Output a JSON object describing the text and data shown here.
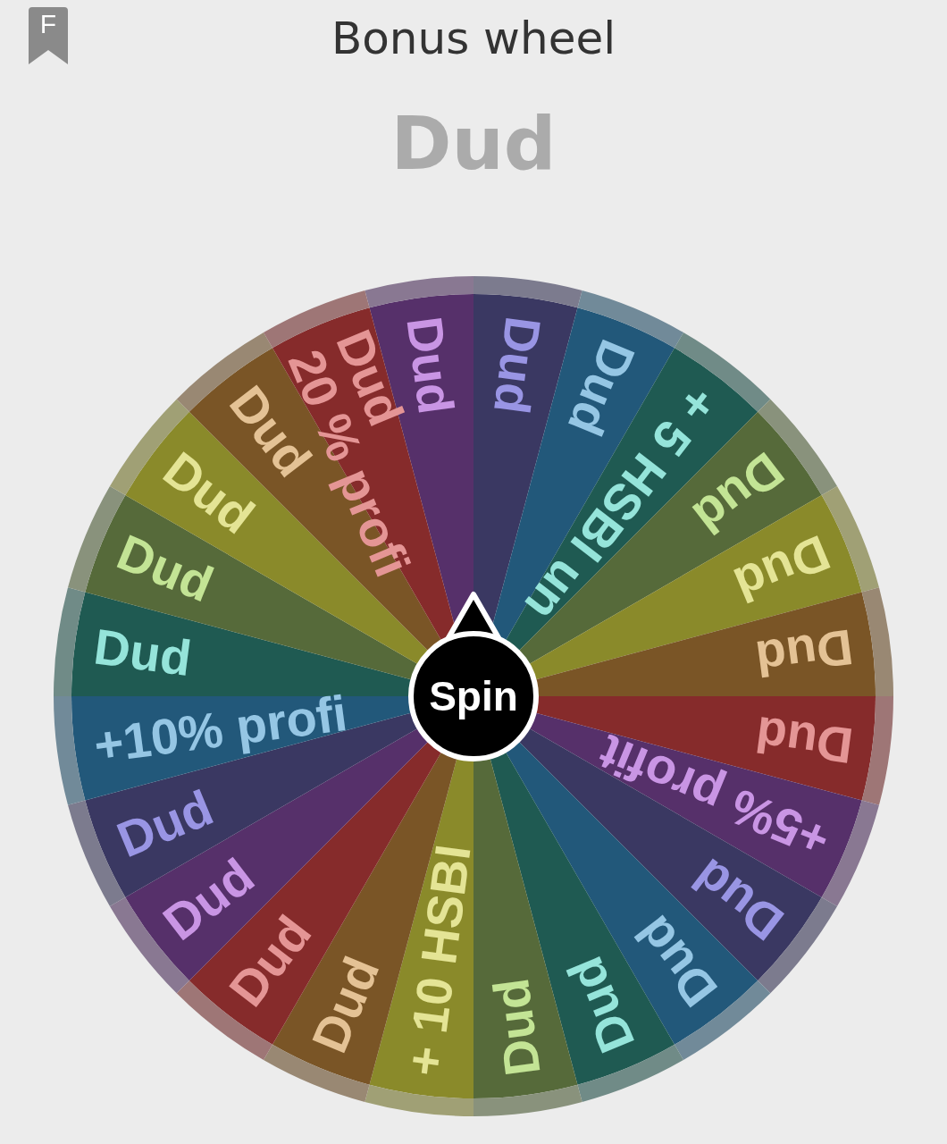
{
  "header": {
    "badge_letter": "F",
    "title": "Bonus wheel"
  },
  "result": "Dud",
  "wheel": {
    "segments": [
      {
        "lines": [
          "Dud"
        ],
        "color": "#56306a"
      },
      {
        "lines": [
          "Dud"
        ],
        "color": "#3a3862"
      },
      {
        "lines": [
          "Dud"
        ],
        "color": "#22587a"
      },
      {
        "lines": [
          "+ 5 HSBI un"
        ],
        "color": "#1f5a52"
      },
      {
        "lines": [
          "Dud"
        ],
        "color": "#566a3a"
      },
      {
        "lines": [
          "Dud"
        ],
        "color": "#8a8a2a"
      },
      {
        "lines": [
          "Dud"
        ],
        "color": "#7a5526"
      },
      {
        "lines": [
          "Dud"
        ],
        "color": "#862b2b"
      },
      {
        "lines": [
          "+5% profit"
        ],
        "color": "#56306a"
      },
      {
        "lines": [
          "Dud"
        ],
        "color": "#3a3862"
      },
      {
        "lines": [
          "Dud"
        ],
        "color": "#22587a"
      },
      {
        "lines": [
          "Dud"
        ],
        "color": "#1f5a52"
      },
      {
        "lines": [
          "Dud"
        ],
        "color": "#566a3a"
      },
      {
        "lines": [
          "+ 10 HSBI"
        ],
        "color": "#8a8a2a"
      },
      {
        "lines": [
          "Dud"
        ],
        "color": "#7a5526"
      },
      {
        "lines": [
          "Dud"
        ],
        "color": "#862b2b"
      },
      {
        "lines": [
          "Dud"
        ],
        "color": "#56306a"
      },
      {
        "lines": [
          "Dud"
        ],
        "color": "#3a3862"
      },
      {
        "lines": [
          "+10% profi"
        ],
        "color": "#22587a"
      },
      {
        "lines": [
          "Dud"
        ],
        "color": "#1f5a52"
      },
      {
        "lines": [
          "Dud"
        ],
        "color": "#566a3a"
      },
      {
        "lines": [
          "Dud"
        ],
        "color": "#8a8a2a"
      },
      {
        "lines": [
          "Dud"
        ],
        "color": "#7a5526"
      },
      {
        "lines": [
          "Dud",
          "20 % profi"
        ],
        "color": "#862b2b"
      }
    ],
    "spin_label": "Spin"
  }
}
